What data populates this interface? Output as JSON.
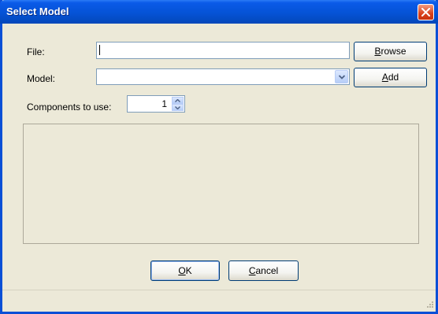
{
  "window": {
    "title": "Select Model"
  },
  "file": {
    "label": "File:",
    "value": "",
    "browse_label": "Browse",
    "browse_mnemonic": "B",
    "browse_rest": "rowse"
  },
  "model": {
    "label": "Model:",
    "selected": "",
    "add_label": "Add",
    "add_mnemonic": "A",
    "add_rest": "dd"
  },
  "components": {
    "label": "Components to use:",
    "value": "1"
  },
  "footer": {
    "ok_label": "OK",
    "ok_mnemonic": "O",
    "ok_rest": "K",
    "cancel_label": "Cancel",
    "cancel_mnemonic": "C",
    "cancel_rest": "ancel"
  },
  "colors": {
    "titlebar": "#0553d6",
    "dialog_bg": "#ece9d8",
    "close_button": "#d9411b"
  },
  "icons": [
    "close-icon",
    "chevron-down-icon",
    "spin-up-icon",
    "spin-down-icon",
    "resize-grip-icon"
  ]
}
